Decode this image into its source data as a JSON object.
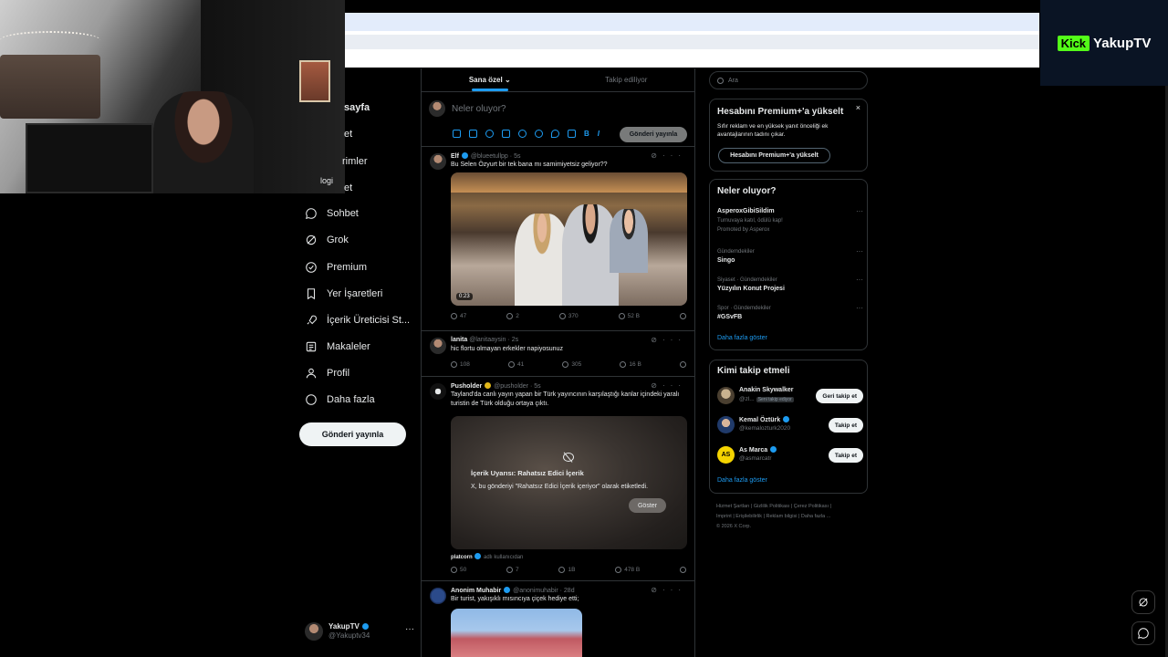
{
  "stream": {
    "platform_badge": "Kick",
    "channel_name": "YakupTV",
    "overlay_text": "logi"
  },
  "nav": {
    "items": [
      {
        "label": "sayfa",
        "icon": "home-icon"
      },
      {
        "label": "et",
        "icon": "explore-icon"
      },
      {
        "label": "rimler",
        "icon": "notifications-icon"
      },
      {
        "label": "et",
        "icon": "messages-icon"
      },
      {
        "label": "Sohbet",
        "icon": "chat-icon"
      },
      {
        "label": "Grok",
        "icon": "grok-icon"
      },
      {
        "label": "Premium",
        "icon": "premium-icon"
      },
      {
        "label": "Yer İşaretleri",
        "icon": "bookmark-icon"
      },
      {
        "label": "İçerik Üreticisi St...",
        "icon": "rocket-icon"
      },
      {
        "label": "Makaleler",
        "icon": "articles-icon"
      },
      {
        "label": "Profil",
        "icon": "person-icon"
      },
      {
        "label": "Daha fazla",
        "icon": "more-circle-icon"
      }
    ],
    "post_button": "Gönderi yayınla",
    "account": {
      "name": "YakupTV",
      "handle": "@Yakuptv34"
    }
  },
  "feed": {
    "tabs": [
      {
        "label": "Sana özel",
        "active": true
      },
      {
        "label": "Takip ediliyor",
        "active": false
      }
    ],
    "composer": {
      "placeholder": "Neler oluyor?",
      "send_label": "Gönderi yayınla"
    },
    "tweets": [
      {
        "name": "Elf",
        "verified": "blue",
        "handle": "@blueetullpp",
        "time": "5s",
        "text": "Bu Selen Özyurt bir tek bana mı samimiyetsiz geliyor??",
        "media": {
          "type": "video",
          "duration": "0:23"
        },
        "stats": {
          "replies": "47",
          "reposts": "2",
          "likes": "370",
          "views": "52 B"
        }
      },
      {
        "name": "lanita",
        "verified": "",
        "handle": "@lanitaaysin",
        "time": "2s",
        "text": "hic flortu olmayan erkekler napiyosunuz",
        "stats": {
          "replies": "108",
          "reposts": "41",
          "likes": "305",
          "views": "16 B"
        }
      },
      {
        "name": "Pusholder",
        "verified": "gold",
        "handle": "@pusholder",
        "time": "5s",
        "text": "Tayland'da canlı yayın yapan bir Türk yayıncının karşılaştığı kanlar içindeki yaralı turistin de Türk olduğu ortaya çıktı.",
        "media": {
          "type": "sensitive",
          "title": "İçerik Uyarısı: Rahatsız Edici İçerik",
          "desc": "X, bu gönderiyi \"Rahatsız Edici İçerik içeriyor\" olarak etiketledi.",
          "button": "Göster"
        },
        "attribution": {
          "name": "platcorn",
          "suffix": "adlı kullanıcıdan"
        },
        "stats": {
          "replies": "50",
          "reposts": "7",
          "likes": "1B",
          "views": "478 B"
        }
      },
      {
        "name": "Anonim Muhabir",
        "verified": "blue",
        "handle": "@anonimuhabir",
        "time": "28d",
        "text": "Bir turist, yakışıklı mısıncıya çiçek hediye etti;"
      }
    ]
  },
  "sidebar": {
    "search_placeholder": "Ara",
    "premium": {
      "title": "Hesabını Premium+'a yükselt",
      "desc": "Sıfır reklam ve en yüksek yanıt önceliği ek avantajlarının tadını çıkar.",
      "button": "Hesabını Premium+'a yükselt",
      "close": "×"
    },
    "trends": {
      "title": "Neler oluyor?",
      "items": [
        {
          "category": "",
          "name": "AsperoxGibiSildim",
          "sub": "Turnuvaya katıl, ödülü kap!",
          "promo": "Promoted by Asperox"
        },
        {
          "category": "Gündemdekiler",
          "name": "Singo"
        },
        {
          "category": "Siyaset · Gündemdekiler",
          "name": "Yüzyılın Konut Projesi"
        },
        {
          "category": "Spor · Gündemdekiler",
          "name": "#GSvFB"
        }
      ],
      "show_more": "Daha fazla göster"
    },
    "follow": {
      "title": "Kimi takip etmeli",
      "users": [
        {
          "name": "Anakin Skywalker",
          "handle": "@zl...",
          "badge": "Seni takip ediyor",
          "button": "Geri takip et"
        },
        {
          "name": "Kemal Öztürk",
          "handle": "@kemalozturk2020",
          "verified": "blue",
          "button": "Takip et"
        },
        {
          "name": "As Marca",
          "handle": "@asmarcatr",
          "verified": "blue",
          "button": "Takip et"
        }
      ],
      "show_more": "Daha fazla göster"
    },
    "footer": {
      "line1": "Hizmet Şartları  |  Gizlilik Politikası  |  Çerez Politikası  |",
      "line2": "Imprint  |  Erişilebilirlik  |  Reklam bilgisi  |  Daha fazla ...",
      "line3": "© 2026 X Corp."
    }
  },
  "colors": {
    "accent": "#1d9bf0",
    "background": "#000000",
    "kick_green": "#53fc18"
  }
}
